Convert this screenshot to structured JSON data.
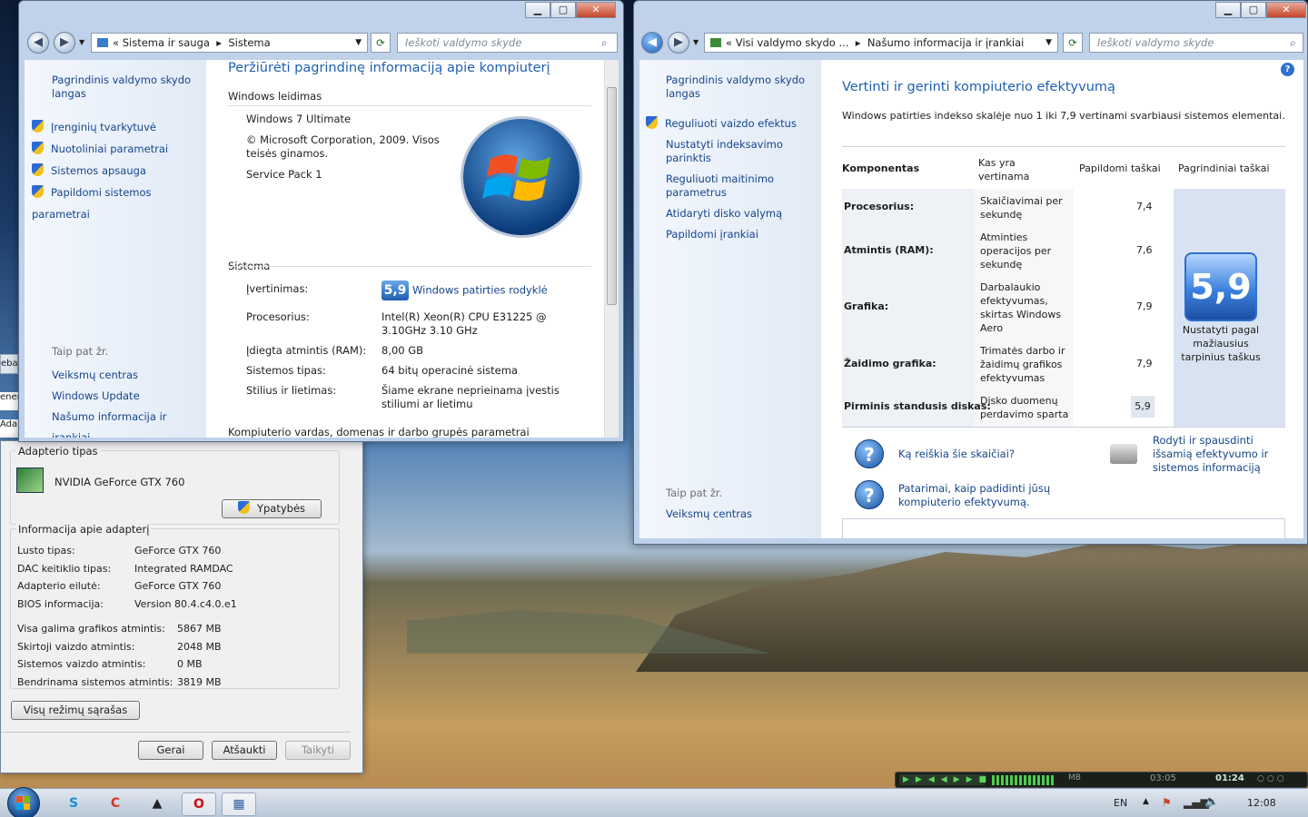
{
  "win1": {
    "address": [
      "«",
      "Sistema ir sauga",
      "▸",
      "Sistema"
    ],
    "search_placeholder": "Ieškoti valdymo skyde",
    "left": {
      "home": "Pagrindinis valdymo skydo langas",
      "tasks": [
        "Įrenginių tvarkytuvė",
        "Nuotoliniai parametrai",
        "Sistemos apsauga",
        "Papildomi sistemos parametrai"
      ],
      "see_also_title": "Taip pat žr.",
      "see_also": [
        "Veiksmų centras",
        "Windows Update",
        "Našumo informacija ir įrankiai"
      ]
    },
    "title": "Peržiūrėti pagrindinę informaciją apie kompiuterį",
    "edition_header": "Windows leidimas",
    "edition": "Windows 7 Ultimate",
    "copyright": "© Microsoft Corporation, 2009. Visos teisės ginamos.",
    "sp": "Service Pack 1",
    "system_header": "Sistema",
    "rows": [
      {
        "k": "Įvertinimas:",
        "v": "Windows patirties rodyklė",
        "badge": "5,9"
      },
      {
        "k": "Procesorius:",
        "v": "Intel(R) Xeon(R) CPU E31225 @ 3.10GHz 3.10 GHz"
      },
      {
        "k": "Įdiegta atmintis (RAM):",
        "v": "8,00 GB"
      },
      {
        "k": "Sistemos tipas:",
        "v": "64 bitų operacinė sistema"
      },
      {
        "k": "Stilius ir lietimas:",
        "v": "Šiame ekrane neprieinama įvestis stiliumi ar lietimu"
      }
    ],
    "footer_header": "Kompiuterio vardas, domenas ir darbo grupės parametrai"
  },
  "win2": {
    "address": [
      "«",
      "Visi valdymo skydo ...",
      "▸",
      "Našumo informacija ir įrankiai"
    ],
    "search_placeholder": "Ieškoti valdymo skyde",
    "left": {
      "home": "Pagrindinis valdymo skydo langas",
      "tasks": [
        "Reguliuoti vaizdo efektus",
        "Nustatyti indeksavimo parinktis",
        "Reguliuoti maitinimo parametrus",
        "Atidaryti disko valymą",
        "Papildomi įrankiai"
      ],
      "see_also_title": "Taip pat žr.",
      "see_also": [
        "Veiksmų centras"
      ]
    },
    "title": "Vertinti ir gerinti kompiuterio efektyvumą",
    "subtitle": "Windows patirties indekso skalėje nuo 1 iki 7,9 vertinami svarbiausi sistemos elementai.",
    "headers": [
      "Komponentas",
      "Kas yra vertinama",
      "Papildomi taškai",
      "Pagrindiniai taškai"
    ],
    "rows": [
      {
        "c": "Procesorius:",
        "w": "Skaičiavimai per sekundę",
        "s": "7,4"
      },
      {
        "c": "Atmintis (RAM):",
        "w": "Atminties operacijos per sekundę",
        "s": "7,6"
      },
      {
        "c": "Grafika:",
        "w": "Darbalaukio efektyvumas, skirtas Windows Aero",
        "s": "7,9"
      },
      {
        "c": "Žaidimo grafika:",
        "w": "Trimatės darbo ir žaidimų grafikos efektyvumas",
        "s": "7,9"
      },
      {
        "c": "Pirminis standusis diskas:",
        "w": "Disko duomenų perdavimo sparta",
        "s": "5,9"
      }
    ],
    "base_score": "5,9",
    "base_caption": "Nustatyti pagal mažiausius tarpinius taškus",
    "help1": "Ką reiškia šie skaičiai?",
    "help2": "Patarimai, kaip padidinti jūsų kompiuterio efektyvumą.",
    "print": "Rodyti ir spausdinti išsamią efektyvumo ir sistemos informaciją"
  },
  "dlg": {
    "adapter_title": "Adapterio tipas",
    "adapter_name": "NVIDIA GeForce GTX 760",
    "props_btn": "Ypatybės",
    "info_title": "Informacija apie adapterį",
    "info": [
      {
        "k": "Lusto tipas:",
        "v": "GeForce GTX 760"
      },
      {
        "k": "DAC keitiklio tipas:",
        "v": "Integrated RAMDAC"
      },
      {
        "k": "Adapterio eilutė:",
        "v": "GeForce GTX 760"
      },
      {
        "k": "BIOS informacija:",
        "v": "Version 80.4.c4.0.e1"
      }
    ],
    "mem": [
      {
        "k": "Visa galima grafikos atmintis:",
        "v": "5867 MB"
      },
      {
        "k": "Skirtoji vaizdo atmintis:",
        "v": "2048 MB"
      },
      {
        "k": "Sistemos vaizdo atmintis:",
        "v": "0 MB"
      },
      {
        "k": "Bendrinama sistemos atmintis:",
        "v": "3819 MB"
      }
    ],
    "modes_btn": "Visų režimų sąrašas",
    "ok": "Gerai",
    "cancel": "Atšaukti",
    "apply": "Taikyti",
    "side_fragments": [
      "eba",
      "ener",
      "Ada"
    ]
  },
  "player": {
    "time1": "03:05",
    "time2": "01:24",
    "mb": "MB"
  },
  "taskbar": {
    "lang": "EN",
    "clock": "12:08"
  },
  "colors": {
    "link": "#15458c",
    "title_blue": "#1e5fb1",
    "accent": "#1f5fb0"
  }
}
